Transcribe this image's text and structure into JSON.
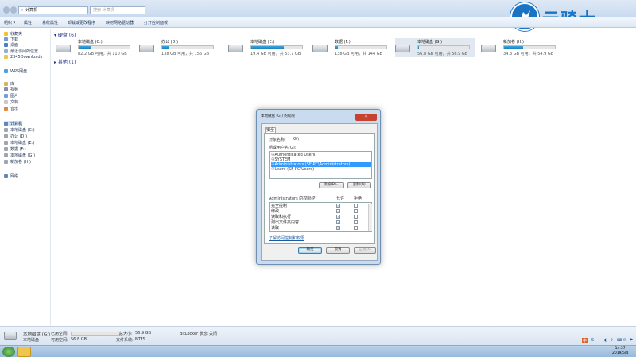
{
  "window": {
    "address_chev": "«",
    "address": "计算机",
    "search_placeholder": "搜索 计算机"
  },
  "logo": {
    "text": "云骑士",
    "icon": "knight-logo-icon"
  },
  "toolbar": [
    "组织 ▾",
    "属性",
    "系统属性",
    "卸载或更改程序",
    "映射网络驱动器",
    "打开控制面板"
  ],
  "sidebar": {
    "items": [
      {
        "label": "收藏夹",
        "icon": "star-icon",
        "color": "#f2c230"
      },
      {
        "label": "下载",
        "icon": "download-folder-icon",
        "color": "#6fa0d8"
      },
      {
        "label": "桌面",
        "icon": "desktop-icon",
        "color": "#4a7fc1"
      },
      {
        "label": "最近访问的位置",
        "icon": "recent-places-icon",
        "color": "#8fb0d8"
      },
      {
        "label": "2345Downloads",
        "icon": "folder-icon",
        "color": "#f0c64a"
      },
      {
        "label": "WPS网盘",
        "icon": "cloud-icon",
        "color": "#4aa3df"
      },
      {
        "label": "库",
        "icon": "library-icon",
        "color": "#d9b55a"
      },
      {
        "label": "视频",
        "icon": "video-icon",
        "color": "#8a8fa6"
      },
      {
        "label": "图片",
        "icon": "picture-icon",
        "color": "#6fa0d8"
      },
      {
        "label": "文档",
        "icon": "document-icon",
        "color": "#c9c9c9"
      },
      {
        "label": "音乐",
        "icon": "music-icon",
        "color": "#e08b3a"
      },
      {
        "label": "计算机",
        "icon": "computer-icon",
        "color": "#5d89b8"
      },
      {
        "label": "本地磁盘 (C:)",
        "icon": "drive-icon",
        "color": "#9ea7b0"
      },
      {
        "label": "办公 (D:)",
        "icon": "drive-icon",
        "color": "#9ea7b0"
      },
      {
        "label": "本地磁盘 (E:)",
        "icon": "drive-icon",
        "color": "#9ea7b0"
      },
      {
        "label": "数据 (F:)",
        "icon": "drive-icon",
        "color": "#9ea7b0"
      },
      {
        "label": "本地磁盘 (G:)",
        "icon": "drive-icon",
        "color": "#9ea7b0"
      },
      {
        "label": "新加卷 (H:)",
        "icon": "drive-icon",
        "color": "#9ea7b0"
      },
      {
        "label": "网络",
        "icon": "network-icon",
        "color": "#5d89b8"
      }
    ]
  },
  "main": {
    "group_disks": "硬盘 (6)",
    "group_other": "其他 (1)",
    "drives": [
      {
        "name": "本地磁盘 (C:)",
        "free": "82.2 GB 可用，共 110 GB",
        "used_fraction": 0.25
      },
      {
        "name": "办公 (D:)",
        "free": "138 GB 可用，共 156 GB",
        "used_fraction": 0.12
      },
      {
        "name": "本地磁盘 (E:)",
        "free": "19.4 GB 可用，共 53.7 GB",
        "used_fraction": 0.64
      },
      {
        "name": "数据 (F:)",
        "free": "138 GB 可用，共 144 GB",
        "used_fraction": 0.04
      },
      {
        "name": "本地磁盘 (G:)",
        "free": "56.8 GB 可用，共 56.9 GB",
        "used_fraction": 0.01
      },
      {
        "name": "新加卷 (H:)",
        "free": "34.3 GB 可用，共 54.9 GB",
        "used_fraction": 0.38
      }
    ]
  },
  "details": {
    "name": "本地磁盘 (G:)",
    "type": "本地磁盘",
    "used_label": "已用空间:",
    "free_label": "可用空间:",
    "free_value": "56.8 GB",
    "total_label": "总大小:",
    "total_value": "56.9 GB",
    "fs_label": "文件系统:",
    "fs_value": "NTFS",
    "bitlocker_label": "BitLocker 状态:",
    "bitlocker_value": "关闭"
  },
  "dialog": {
    "title": "本地磁盘 (G:) 的权限",
    "close": "x",
    "tab": "安全",
    "object_label": "对象名称:",
    "object_value": "G:\\",
    "users_label": "组或用户名(G):",
    "users": [
      "Authenticated Users",
      "SYSTEM",
      "Administrators (SF-PC\\Administrators)",
      "Users (SF-PC\\Users)"
    ],
    "selected_user": 2,
    "add": "添加(D)...",
    "remove": "删除(R)",
    "perm_label": "Administrators 的权限(P)",
    "allow": "允许",
    "deny": "拒绝",
    "perms": [
      {
        "name": "完全控制",
        "allow": true
      },
      {
        "name": "修改",
        "allow": true
      },
      {
        "name": "读取和执行",
        "allow": true
      },
      {
        "name": "列出文件夹内容",
        "allow": true
      },
      {
        "name": "读取",
        "allow": true
      }
    ],
    "link": "了解访问控制和权限",
    "ok": "确定",
    "cancel": "取消",
    "apply": "应用(A)"
  },
  "behind_dialog": {
    "ok": "确定",
    "cancel": "取消",
    "apply": "应用(A)"
  },
  "tray": {
    "ime": "中",
    "icons": [
      "S",
      "·",
      "◐",
      "♪",
      "⌨",
      "✉",
      "⚑"
    ]
  },
  "clock": {
    "time": "14:37",
    "date": "2019/5/4"
  }
}
